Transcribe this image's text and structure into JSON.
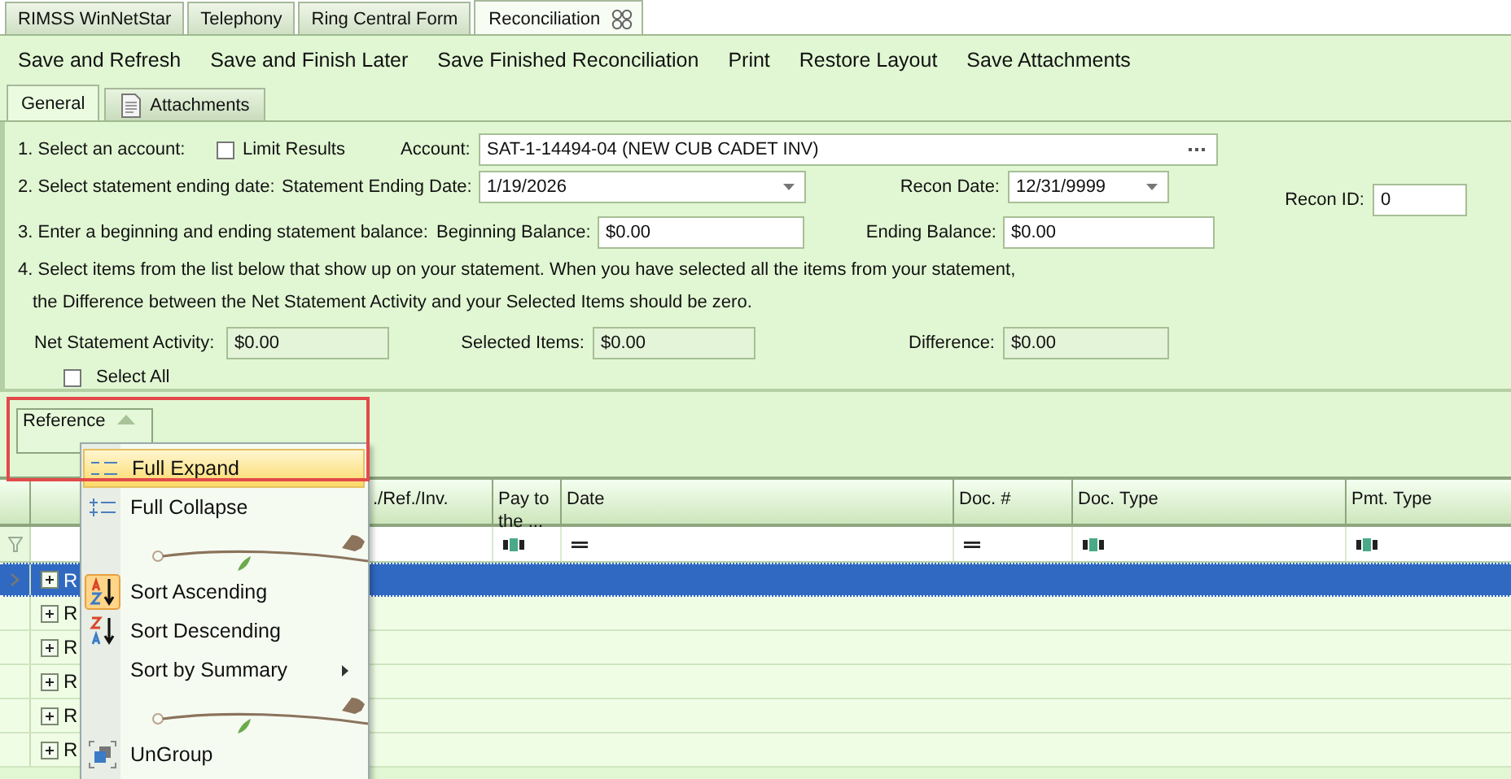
{
  "doc_tabs": [
    {
      "label": "RIMSS WinNetStar",
      "selected": false
    },
    {
      "label": "Telephony",
      "selected": false
    },
    {
      "label": "Ring Central Form",
      "selected": false
    },
    {
      "label": "Reconciliation",
      "selected": true
    }
  ],
  "toolbar": [
    "Save and Refresh",
    "Save and Finish Later",
    "Save Finished Reconciliation",
    "Print",
    "Restore Layout",
    "Save Attachments"
  ],
  "sub_tabs": [
    {
      "label": "General",
      "selected": true,
      "kind": "plain"
    },
    {
      "label": "Attachments",
      "selected": false,
      "kind": "document"
    }
  ],
  "step1": {
    "label": "1. Select an account:",
    "limit_results": {
      "label": "Limit Results",
      "checked": false
    },
    "account": {
      "label": "Account:",
      "value": "SAT-1-14494-04 (NEW CUB CADET INV)"
    }
  },
  "step2": {
    "label": "2. Select statement ending date:",
    "ending_date": {
      "label": "Statement Ending Date:",
      "value": "1/19/2026"
    },
    "recon_date": {
      "label": "Recon Date:",
      "value": "12/31/9999"
    },
    "recon_id": {
      "label": "Recon ID:",
      "value": "0"
    }
  },
  "step3": {
    "label": "3. Enter a beginning and ending statement balance:",
    "beginning": {
      "label": "Beginning Balance:",
      "value": "$0.00"
    },
    "ending": {
      "label": "Ending Balance:",
      "value": "$0.00"
    }
  },
  "step4": {
    "line1": "4. Select items from the list below that show up on your statement. When you have selected all the items from your statement,",
    "line2": "the Difference between the Net Statement Activity and your Selected Items should be zero.",
    "net": {
      "label": "Net Statement Activity:",
      "value": "$0.00"
    },
    "selected_items": {
      "label": "Selected Items:",
      "value": "$0.00"
    },
    "difference": {
      "label": "Difference:",
      "value": "$0.00"
    },
    "select_all": {
      "label": "Select All",
      "checked": false
    }
  },
  "grid": {
    "group_chip": "Reference",
    "columns": [
      {
        "label": "./Ref./Inv.",
        "kind": "none"
      },
      {
        "label": "Pay to the ...",
        "kind": "text"
      },
      {
        "label": "Date",
        "kind": "equals"
      },
      {
        "label": "Doc. #",
        "kind": "equals"
      },
      {
        "label": "Doc. Type",
        "kind": "text"
      },
      {
        "label": "Pmt. Type",
        "kind": "text"
      }
    ],
    "rows": [
      {
        "text": "R",
        "selected": true
      },
      {
        "text": "R",
        "selected": false
      },
      {
        "text": "R",
        "selected": false
      },
      {
        "text": "R",
        "selected": false
      },
      {
        "text": "R",
        "selected": false
      },
      {
        "text": "R",
        "selected": false
      }
    ]
  },
  "context_menu": [
    {
      "kind": "expand",
      "label": "Full Expand",
      "highlighted": true
    },
    {
      "kind": "collapse",
      "label": "Full Collapse",
      "highlighted": false
    },
    {
      "kind": "separator"
    },
    {
      "kind": "sort_asc",
      "label": "Sort Ascending",
      "highlighted": false
    },
    {
      "kind": "sort_desc",
      "label": "Sort Descending",
      "highlighted": false
    },
    {
      "kind": "submenu",
      "label": "Sort by Summary",
      "highlighted": false
    },
    {
      "kind": "separator"
    },
    {
      "kind": "ungroup",
      "label": "UnGroup",
      "highlighted": false
    }
  ],
  "annotation_frame": true
}
